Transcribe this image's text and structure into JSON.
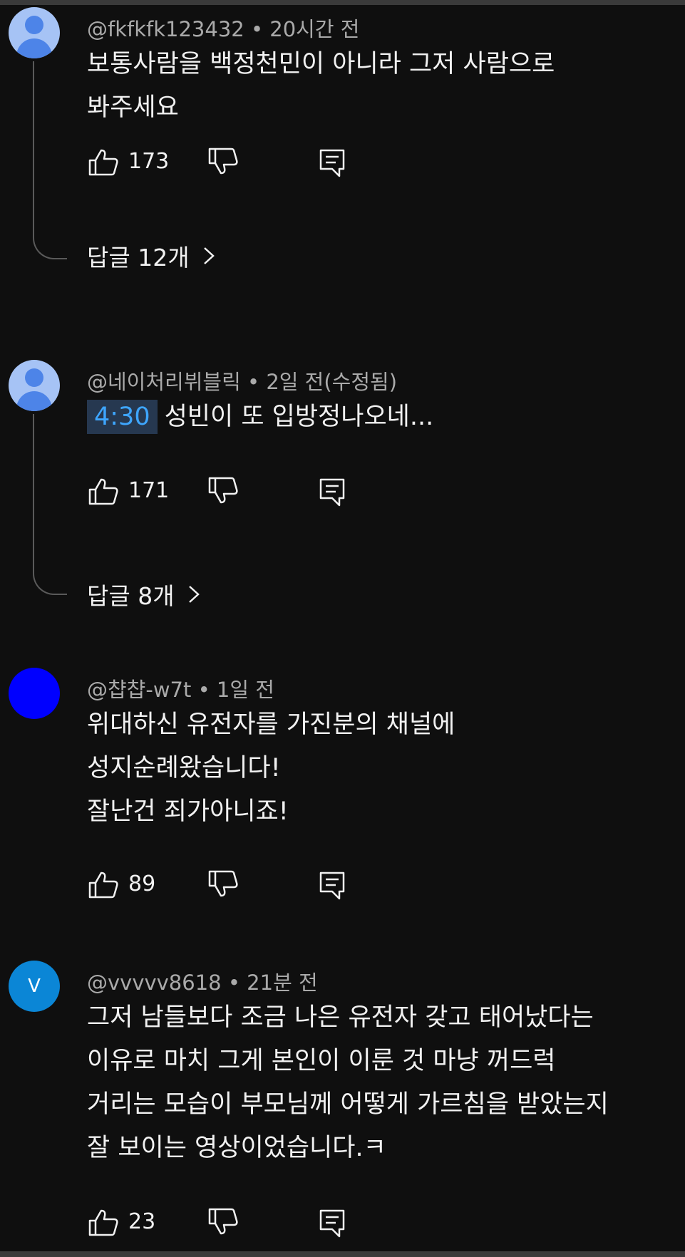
{
  "comments": [
    {
      "author": "@fkfkfk123432",
      "separator": "•",
      "time": "20시간 전",
      "lines": [
        "보통사람을 백정천민이 아니라 그저 사람으로",
        "봐주세요"
      ],
      "likes": "173",
      "replies_label": "답글 12개",
      "avatar": "default-person-icon"
    },
    {
      "author": "@네이처리뷔블릭",
      "separator": "•",
      "time": "2일 전(수정됨)",
      "timestamp": "4:30",
      "lines": [
        "성빈이 또 입방정나오네..."
      ],
      "likes": "171",
      "replies_label": "답글 8개",
      "avatar": "default-person-icon"
    },
    {
      "author": "@챱챱-w7t",
      "separator": "•",
      "time": "1일 전",
      "lines": [
        "위대하신 유전자를 가진분의 채널에",
        "성지순례왔습니다!",
        "잘난건 죄가아니죠!"
      ],
      "likes": "89",
      "avatar": "blue-avatar"
    },
    {
      "author": "@vvvvv8618",
      "separator": "•",
      "time": "21분 전",
      "avatar_letter": "V",
      "lines": [
        "그저 남들보다 조금 나은 유전자 갖고 태어났다는",
        "이유로 마치 그게 본인이 이룬 것 마냥 꺼드럭",
        "거리는 모습이 부모님께 어떻게 가르침을 받았는지",
        "잘 보이는 영상이었습니다.ㅋ"
      ],
      "likes": "23",
      "avatar": "letter-avatar"
    }
  ],
  "icons": {
    "like": "thumbs-up-icon",
    "dislike": "thumbs-down-icon",
    "reply": "reply-icon",
    "chevron": "chevron-right-icon"
  },
  "colors": {
    "background": "#0f0f0f",
    "text": "#f1f1f1",
    "meta": "#aaaaaa",
    "timestamp_link": "#3ea6ff",
    "timestamp_bg": "#263850",
    "avatar_default": "#a6c3f5",
    "avatar_blue": "#0000ff",
    "avatar_letter": "#0b86d6"
  }
}
